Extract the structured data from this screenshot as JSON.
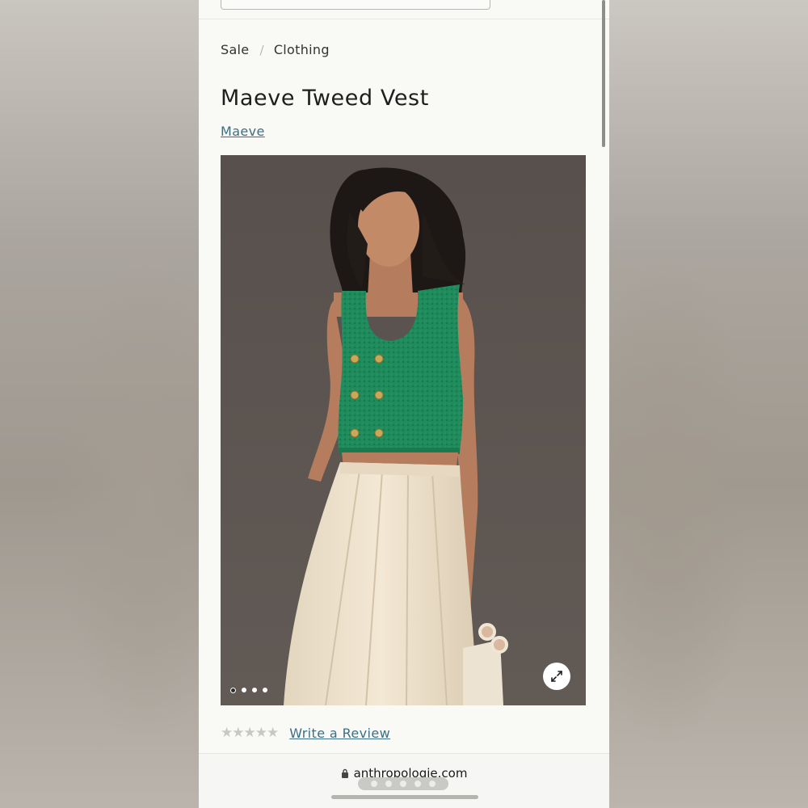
{
  "breadcrumb": {
    "items": [
      "Sale",
      "Clothing"
    ],
    "separator": "/"
  },
  "product": {
    "title": "Maeve Tweed Vest",
    "brand": "Maeve",
    "image_icon_expand": "expand-arrows-icon",
    "carousel": {
      "total_images": 4,
      "active_index": 0
    }
  },
  "reviews": {
    "stars": "★★★★★",
    "rating": 0,
    "write_review_label": "Write a Review"
  },
  "browser": {
    "url": "anthropologie.com",
    "lock_icon": "lock-icon",
    "tab_dots": 5
  },
  "colors": {
    "link": "#3c6f86",
    "vest_green": "#1e8a5a",
    "skirt_cream": "#efe4d0",
    "photo_bg": "#5c5551"
  }
}
